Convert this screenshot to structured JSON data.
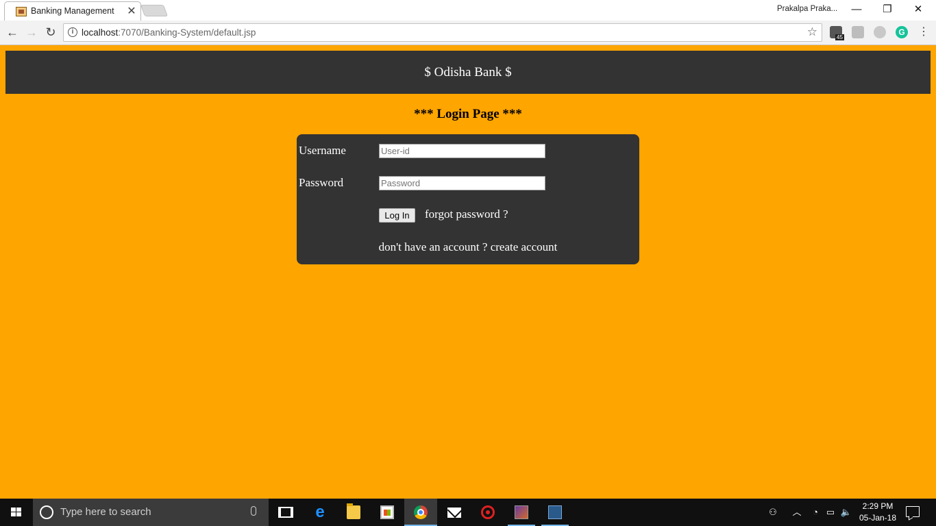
{
  "browser": {
    "tab": {
      "title": "Banking Management",
      "close_glyph": "✕"
    },
    "profile_name": "Prakalpa Praka...",
    "window_controls": {
      "minimize": "—",
      "maximize": "❐",
      "close": "✕"
    },
    "nav": {
      "back": "←",
      "forward": "→",
      "reload": "↻"
    },
    "url": {
      "host": "localhost",
      "rest": ":7070/Banking-System/default.jsp"
    },
    "extensions": {
      "badge_count": "45",
      "grammarly_letter": "G"
    },
    "menu_glyph": "⋮",
    "star_glyph": "☆"
  },
  "page": {
    "header_title": "$ Odisha Bank $",
    "login_heading": "*** Login Page ***",
    "form": {
      "username_label": "Username",
      "username_placeholder": "User-id",
      "password_label": "Password",
      "password_placeholder": "Password",
      "login_button": "Log In",
      "forgot_link": "forgot password ?",
      "signup_prompt": "don't have an account ?",
      "signup_link": "create account"
    }
  },
  "taskbar": {
    "search_placeholder": "Type here to search",
    "apps": [
      "task-view",
      "edge",
      "file-explorer",
      "store",
      "chrome",
      "mail",
      "settings-app",
      "game-app",
      "mysql-workbench"
    ],
    "active_app": "chrome",
    "tray": {
      "people": "⚇",
      "chevron": "︿",
      "wifi": "◔",
      "battery": "▭",
      "volume": "🔈"
    },
    "clock": {
      "time": "2:29 PM",
      "date": "05-Jan-18"
    }
  },
  "colors": {
    "page_background": "#ffa500",
    "header_background": "#333333",
    "login_box_background": "#333333",
    "taskbar_background": "#101010"
  }
}
